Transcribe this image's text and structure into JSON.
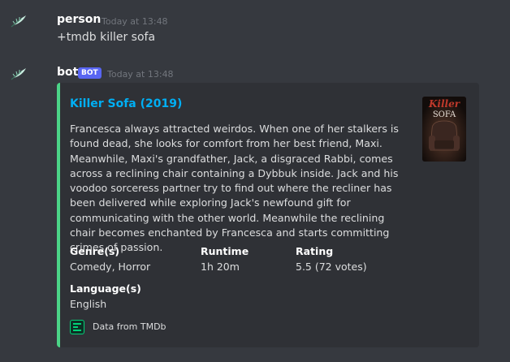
{
  "messages": [
    {
      "author": "person",
      "timestamp": "Today at 13:48",
      "text": "+tmdb killer sofa"
    },
    {
      "author": "bot",
      "badge": "BOT",
      "timestamp": "Today at 13:48",
      "embed": {
        "accent_color": "#4bd487",
        "title": "Killer Sofa (2019)",
        "description": "Francesca always attracted weirdos. When one of her stalkers is found dead, she looks for comfort from her best friend, Maxi. Meanwhile, Maxi's grandfather, Jack, a disgraced Rabbi, comes across a reclining chair containing a Dybbuk inside. Jack and his voodoo sorceress partner try to find out where the recliner has been delivered while exploring Jack's newfound gift for communicating with the other world. Meanwhile the reclining chair becomes enchanted by Francesca and starts committing crimes of passion.",
        "thumbnail": {
          "line1": "Killer",
          "line2": "SOFA"
        },
        "fields": [
          {
            "name": "Genre(s)",
            "value": "Comedy, Horror"
          },
          {
            "name": "Runtime",
            "value": "1h 20m"
          },
          {
            "name": "Rating",
            "value": "5.5 (72 votes)"
          },
          {
            "name": "Language(s)",
            "value": "English"
          }
        ],
        "footer": {
          "icon": "tmdb-logo-icon",
          "text": "Data from TMDb"
        }
      }
    }
  ],
  "colors": {
    "background": "#36393f",
    "embed_background": "#2f3136",
    "link": "#00aff4",
    "badge": "#5865f2"
  }
}
